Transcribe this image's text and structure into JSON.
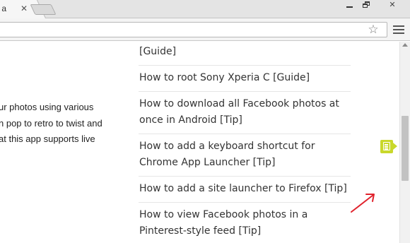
{
  "browser": {
    "tab_title": "s a",
    "tab_close_glyph": "✕",
    "star_glyph": "☆",
    "window_close_glyph": "✕"
  },
  "article": {
    "lines": [
      "ur photos using various",
      "n pop to retro to twist and",
      "at this app supports live"
    ]
  },
  "related_links": [
    "[Guide]",
    "How to root Sony Xperia C [Guide]",
    "How to download all Facebook photos at once in Android [Tip]",
    "How to add a keyboard shortcut for Chrome App Launcher [Tip]",
    "How to add a site launcher to Firefox [Tip]",
    "How to view Facebook photos in a Pinterest-style feed [Tip]"
  ],
  "colors": {
    "note_icon": "#c9d82b",
    "annotation_arrow": "#e0232d"
  },
  "icons": {
    "note": "note-icon",
    "arrow": "annotation-arrow-icon"
  }
}
